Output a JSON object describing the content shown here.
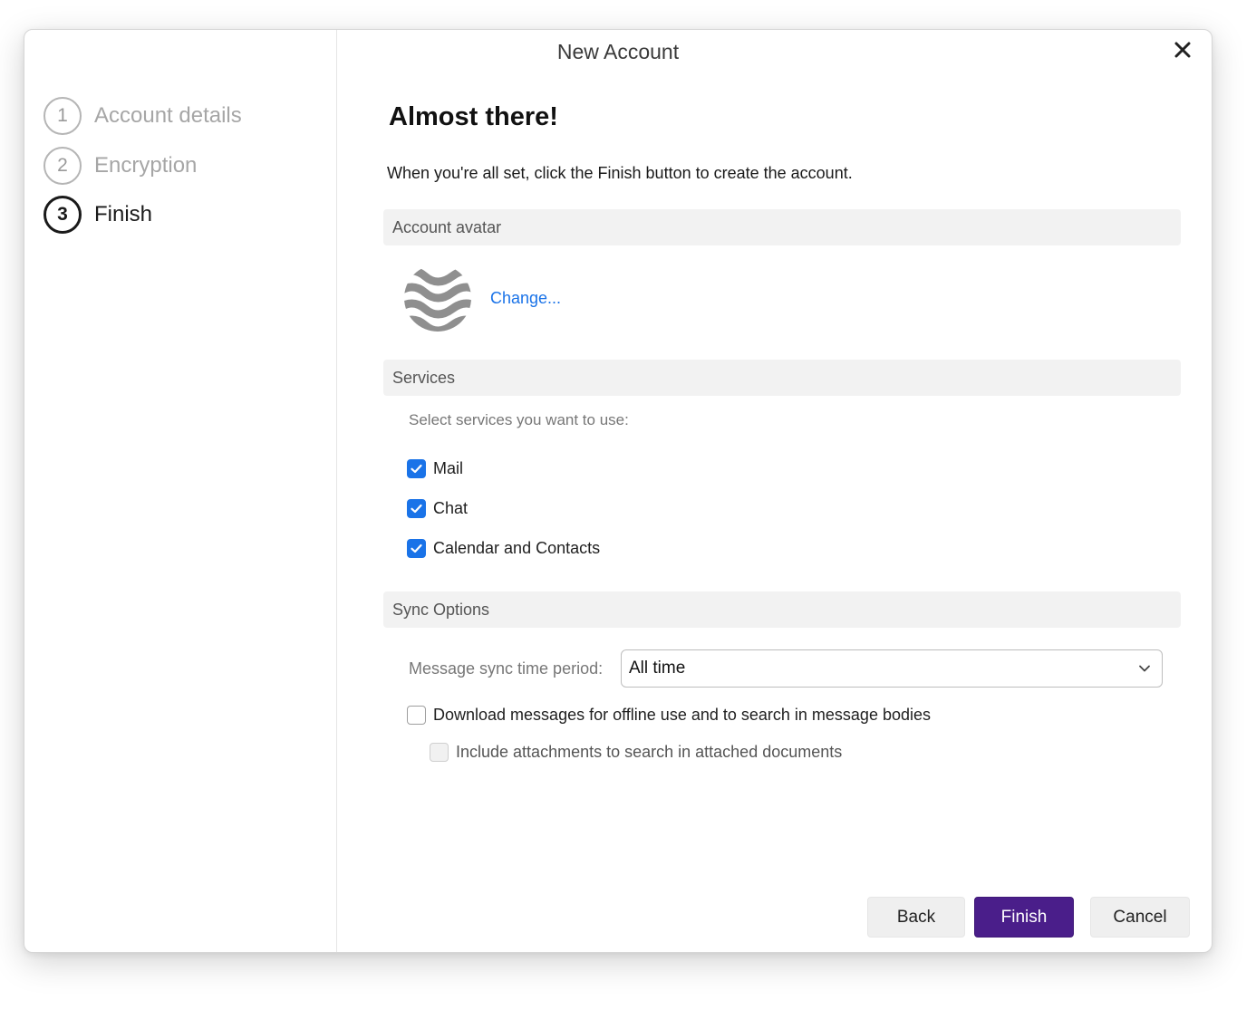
{
  "dialog": {
    "title": "New Account"
  },
  "steps": [
    {
      "number": "1",
      "label": "Account details"
    },
    {
      "number": "2",
      "label": "Encryption"
    },
    {
      "number": "3",
      "label": "Finish"
    }
  ],
  "content": {
    "heading": "Almost there!",
    "intro": "When you're all set, click the Finish button to create the account."
  },
  "avatar": {
    "section_title": "Account avatar",
    "change_label": "Change..."
  },
  "services": {
    "section_title": "Services",
    "hint": "Select services you want to use:",
    "items": [
      {
        "label": "Mail",
        "checked": true
      },
      {
        "label": "Chat",
        "checked": true
      },
      {
        "label": "Calendar and Contacts",
        "checked": true
      }
    ]
  },
  "sync": {
    "section_title": "Sync Options",
    "period_label": "Message sync time period:",
    "period_value": "All time",
    "offline_label": "Download messages for offline use and to search in message bodies",
    "attachments_label": "Include attachments to search in attached documents"
  },
  "buttons": {
    "back": "Back",
    "finish": "Finish",
    "cancel": "Cancel"
  },
  "colors": {
    "accent": "#1a73e8",
    "primary_button": "#4a1e8a"
  }
}
